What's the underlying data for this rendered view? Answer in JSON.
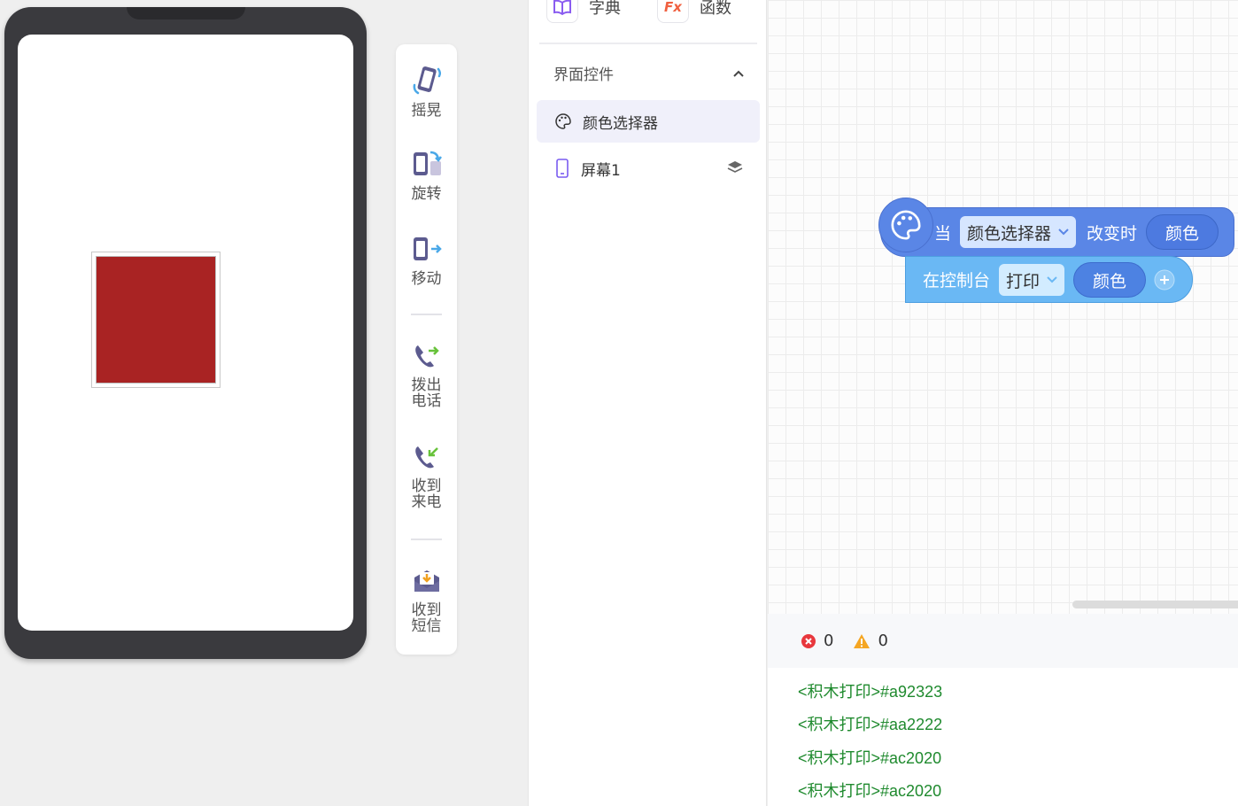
{
  "phone": {
    "widget_color": "#a92323"
  },
  "toolbar": {
    "items": [
      {
        "label": "摇晃",
        "icon": "shake-phone-icon"
      },
      {
        "label": "旋转",
        "icon": "rotate-phone-icon"
      },
      {
        "label": "移动",
        "icon": "move-phone-icon"
      },
      {
        "label": "拨出\n电话",
        "icon": "outgoing-call-icon"
      },
      {
        "label": "收到\n来电",
        "icon": "incoming-call-icon"
      },
      {
        "label": "收到\n短信",
        "icon": "sms-received-icon"
      }
    ]
  },
  "panel": {
    "tabs": [
      {
        "label": "字典",
        "icon": "dictionary-book-icon"
      },
      {
        "label": "函数",
        "icon": "function-fx-icon",
        "icon_text": "Fx"
      }
    ],
    "section_title": "界面控件",
    "components": [
      {
        "name": "颜色选择器",
        "icon": "palette-icon",
        "selected": true
      },
      {
        "name": "屏幕1",
        "icon": "phone-screen-icon",
        "selected": false
      }
    ]
  },
  "blocks": {
    "event": {
      "when": "当",
      "component": "颜色选择器",
      "event": "改变时",
      "param": "颜色",
      "color": "#5a86e6"
    },
    "statement": {
      "label": "在控制台",
      "action": "打印",
      "arg": "颜色",
      "color": "#6ab8f4"
    }
  },
  "console": {
    "errors": "0",
    "warnings": "0",
    "lines": [
      "<积木打印>#a92323",
      "<积木打印>#aa2222",
      "<积木打印>#ac2020",
      "<积木打印>#ac2020"
    ]
  }
}
